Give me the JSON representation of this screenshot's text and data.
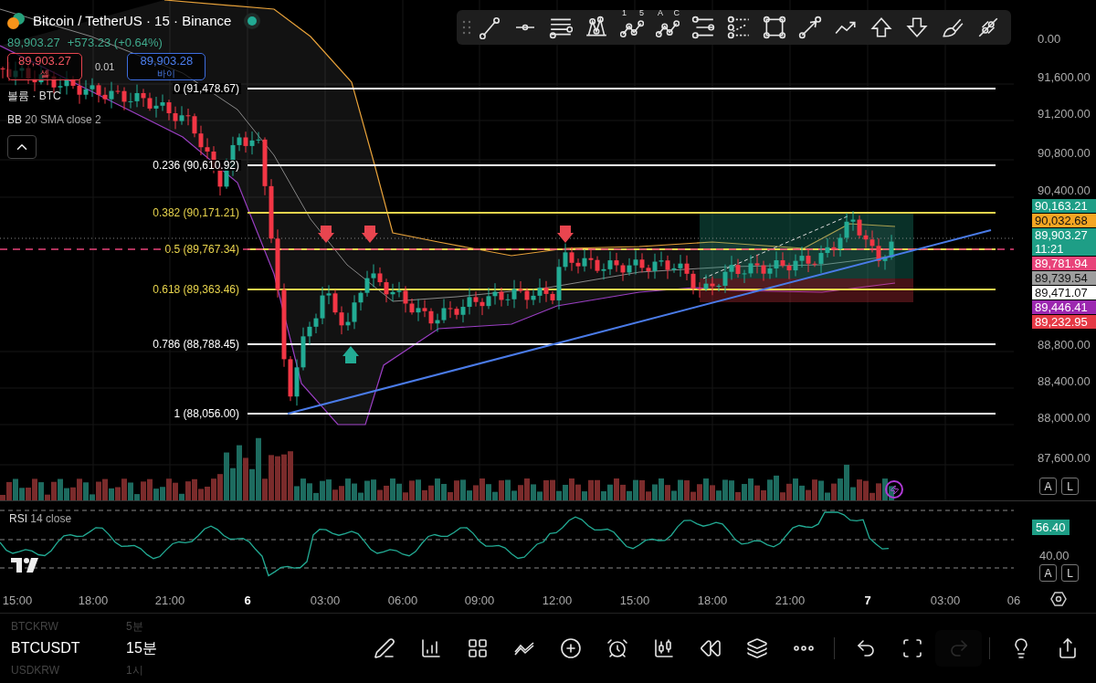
{
  "header": {
    "title": "Bitcoin / TetherUS · 15 · Binance",
    "market_open": true,
    "price": "89,903.27",
    "change": "+573.23 (+0.64%)",
    "sell": {
      "price": "89,903.27",
      "label": "셀"
    },
    "spread": "0.01",
    "buy": {
      "price": "89,903.28",
      "label": "바이"
    },
    "indicators": [
      {
        "name": "볼륨 · BTC"
      },
      {
        "name": "BB",
        "params": "20 SMA close 2"
      }
    ]
  },
  "drawing_toolbar": {
    "tools": [
      {
        "kind": "line"
      },
      {
        "kind": "hline"
      },
      {
        "kind": "fib"
      },
      {
        "kind": "pattern"
      },
      {
        "kind": "wave",
        "labels": [
          "1",
          "5"
        ]
      },
      {
        "kind": "wave",
        "labels": [
          "A",
          "C"
        ]
      },
      {
        "kind": "channel"
      },
      {
        "kind": "channel2"
      },
      {
        "kind": "rect"
      },
      {
        "kind": "arrow"
      },
      {
        "kind": "trend"
      },
      {
        "kind": "up"
      },
      {
        "kind": "down"
      },
      {
        "kind": "brush"
      },
      {
        "kind": "measure"
      }
    ]
  },
  "fib_levels": [
    {
      "label": "0 (91,478.67)",
      "color": "#ffffff"
    },
    {
      "label": "0.236 (90,610.92)",
      "color": "#ffffff"
    },
    {
      "label": "0.382 (90,171.21)",
      "color": "#e8d44d"
    },
    {
      "label": "0.5 (89,767.34)",
      "color": "#e8d44d"
    },
    {
      "label": "0.618 (89,363.46)",
      "color": "#e8d44d"
    },
    {
      "label": "0.786 (88,788.45)",
      "color": "#ffffff"
    },
    {
      "label": "1 (88,056.00)",
      "color": "#ffffff"
    }
  ],
  "price_axis": {
    "labels": [
      "0.00",
      "91,600.00",
      "91,200.00",
      "90,800.00",
      "90,400.00",
      "88,800.00",
      "88,400.00",
      "88,000.00",
      "87,600.00"
    ],
    "tags": [
      {
        "price": "90,163.21",
        "color": "#1e9e86"
      },
      {
        "price": "90,032.68",
        "color": "#f5a623"
      },
      {
        "price": "89,903.27",
        "countdown": "11:21",
        "color": "#1e9e86"
      },
      {
        "price": "89,781.94",
        "color": "#e8437a"
      },
      {
        "price": "89,739.54",
        "color": "#9e9e9e"
      },
      {
        "price": "89,471.07",
        "color": "#ffffff"
      },
      {
        "price": "89,446.41",
        "color": "#9c27b0"
      },
      {
        "price": "89,232.95",
        "color": "#e53945"
      }
    ],
    "buttons": [
      "A",
      "L"
    ]
  },
  "rsi": {
    "title": "RSI",
    "params": "14 close",
    "value": "56.40",
    "axis_label": "40.00",
    "buttons": [
      "A",
      "L"
    ]
  },
  "time_axis": [
    {
      "label": "15:00",
      "kind": "time"
    },
    {
      "label": "18:00",
      "kind": "time"
    },
    {
      "label": "21:00",
      "kind": "time"
    },
    {
      "label": "6",
      "kind": "day"
    },
    {
      "label": "03:00",
      "kind": "time"
    },
    {
      "label": "06:00",
      "kind": "time"
    },
    {
      "label": "09:00",
      "kind": "time"
    },
    {
      "label": "12:00",
      "kind": "time"
    },
    {
      "label": "15:00",
      "kind": "time"
    },
    {
      "label": "18:00",
      "kind": "time"
    },
    {
      "label": "21:00",
      "kind": "time"
    },
    {
      "label": "7",
      "kind": "day"
    },
    {
      "label": "03:00",
      "kind": "time"
    },
    {
      "label": "06",
      "kind": "time"
    }
  ],
  "symbols": [
    {
      "symbol": "BTCKRW",
      "interval": "5분",
      "selected": false
    },
    {
      "symbol": "BTCUSDT",
      "interval": "15분",
      "selected": true
    },
    {
      "symbol": "USDKRW",
      "interval": "1시",
      "selected": false
    }
  ],
  "bottom_toolbar": [
    {
      "kind": "draw",
      "disabled": false
    },
    {
      "kind": "indicators",
      "disabled": false
    },
    {
      "kind": "layout",
      "disabled": false
    },
    {
      "kind": "compare",
      "disabled": false
    },
    {
      "kind": "add",
      "disabled": false
    },
    {
      "kind": "alert",
      "disabled": false
    },
    {
      "kind": "chart-type",
      "disabled": false
    },
    {
      "kind": "replay",
      "disabled": false
    },
    {
      "kind": "layers",
      "disabled": false
    },
    {
      "kind": "more",
      "disabled": false
    },
    {
      "kind": "undo",
      "disabled": false
    },
    {
      "kind": "fullscreen",
      "disabled": false
    },
    {
      "kind": "redo",
      "disabled": true
    },
    {
      "kind": "ideas",
      "disabled": false
    },
    {
      "kind": "share",
      "disabled": false
    }
  ]
}
